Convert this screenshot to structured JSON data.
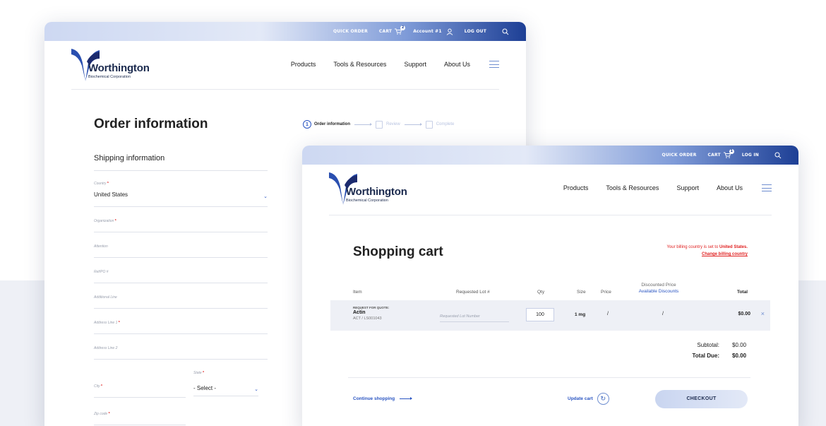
{
  "colors": {
    "accent": "#2a55c2",
    "brand_dark": "#1d3f95",
    "required": "#e02020",
    "band": "#eef0f6"
  },
  "topbar_checkout": {
    "quick_order": "QUICK ORDER",
    "cart": "CART",
    "cart_count": "2",
    "account": "Account #1",
    "logout": "LOG OUT",
    "icons": [
      "cart-icon",
      "user-icon",
      "search-icon"
    ]
  },
  "topbar_cart": {
    "quick_order": "QUICK ORDER",
    "cart": "CART",
    "cart_count": "1",
    "login": "LOG IN",
    "icons": [
      "cart-icon",
      "search-icon"
    ]
  },
  "brand": {
    "name": "Worthington",
    "sub": "Biochemical Corporation"
  },
  "nav": [
    "Products",
    "Tools & Resources",
    "Support",
    "About Us"
  ],
  "order": {
    "title": "Order information",
    "steps": [
      "Order information",
      "Review",
      "Complete"
    ],
    "step_index": "1",
    "shipping_heading": "Shipping information",
    "fields": {
      "country": {
        "label": "Country",
        "required": "*",
        "value": "United States"
      },
      "organization": {
        "label": "Organization",
        "required": "*"
      },
      "attention": {
        "label": "Attention"
      },
      "ref": {
        "label": "Ref/PO #"
      },
      "additional": {
        "label": "Additional Line"
      },
      "address1": {
        "label": "Address Line 1",
        "required": "*"
      },
      "address2": {
        "label": "Address Line 2"
      },
      "city": {
        "label": "City",
        "required": "*"
      },
      "state": {
        "label": "State",
        "required": "*",
        "value": "- Select -"
      },
      "zip": {
        "label": "Zip code",
        "required": "*"
      }
    }
  },
  "cart": {
    "title": "Shopping cart",
    "billing_text": "Your billing country is set to",
    "billing_country": "United States.",
    "billing_change": "Change billing country",
    "columns": {
      "item": "Item",
      "lot": "Requested Lot #",
      "qty": "Qty",
      "size": "Size",
      "price": "Price",
      "discounted": "Discounted Price",
      "available": "Available Discounts",
      "total": "Total"
    },
    "row": {
      "rfq": "REQUEST FOR QUOTE:",
      "name": "Actin",
      "code": "ACT / LS001043",
      "lot_placeholder": "Requested Lot Number",
      "qty": "100",
      "size": "1 mg",
      "price": "/",
      "discounted": "/",
      "total": "$0.00",
      "remove": "×"
    },
    "subtotal_label": "Subtotal:",
    "subtotal": "$0.00",
    "total_due_label": "Total Due:",
    "total_due": "$0.00",
    "continue": "Continue shopping",
    "update": "Update cart",
    "checkout": "CHECKOUT"
  }
}
